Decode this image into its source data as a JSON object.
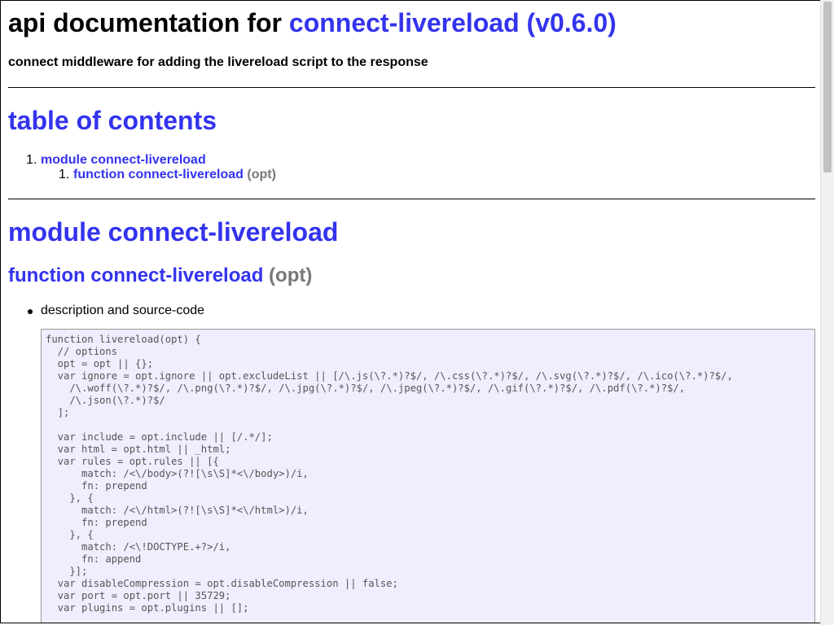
{
  "header": {
    "title_prefix": "api documentation for",
    "title_link": "connect-livereload (v0.6.0)",
    "subtitle": "connect middleware for adding the livereload script to the response"
  },
  "toc": {
    "heading": "table of contents",
    "items": [
      {
        "number": "1.",
        "label": "module connect-livereload",
        "children": [
          {
            "number": "1.",
            "label": "function connect-livereload",
            "params": "(opt)"
          }
        ]
      }
    ]
  },
  "module": {
    "heading": "module connect-livereload",
    "function": {
      "label": "function connect-livereload",
      "params": "(opt)",
      "bullet": "description and source-code",
      "source": "function livereload(opt) {\n  // options\n  opt = opt || {};\n  var ignore = opt.ignore || opt.excludeList || [/\\.js(\\?.*)?$/, /\\.css(\\?.*)?$/, /\\.svg(\\?.*)?$/, /\\.ico(\\?.*)?$/,\n    /\\.woff(\\?.*)?$/, /\\.png(\\?.*)?$/, /\\.jpg(\\?.*)?$/, /\\.jpeg(\\?.*)?$/, /\\.gif(\\?.*)?$/, /\\.pdf(\\?.*)?$/,\n    /\\.json(\\?.*)?$/\n  ];\n\n  var include = opt.include || [/.*/];\n  var html = opt.html || _html;\n  var rules = opt.rules || [{\n      match: /<\\/body>(?![\\s\\S]*<\\/body>)/i,\n      fn: prepend\n    }, {\n      match: /<\\/html>(?![\\s\\S]*<\\/html>)/i,\n      fn: prepend\n    }, {\n      match: /<\\!DOCTYPE.+?>/i,\n      fn: append\n    }];\n  var disableCompression = opt.disableCompression || false;\n  var port = opt.port || 35729;\n  var plugins = opt.plugins || [];"
    }
  },
  "colors": {
    "link": "#3333ee",
    "muted": "#777777",
    "code_background": "#eeeeff"
  }
}
